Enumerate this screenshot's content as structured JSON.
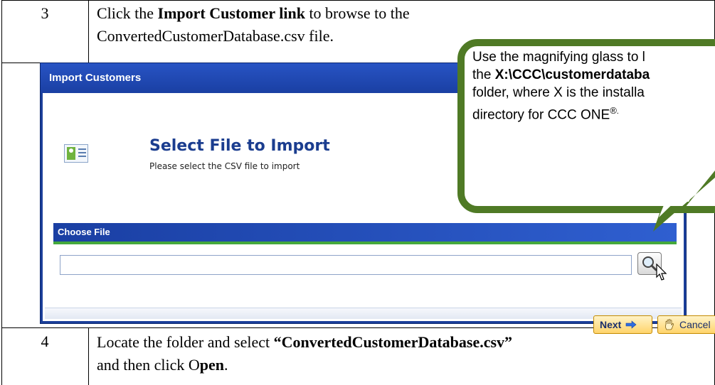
{
  "step3": {
    "number": "3",
    "prefix": "Click the ",
    "link": "Import Customer link",
    "suffix": " to browse to the",
    "line2": "ConvertedCustomerDatabase.csv file."
  },
  "step4": {
    "number": "4",
    "prefix": "Locate the folder and select ",
    "file": "“ConvertedCustomerDatabase.csv”",
    "line2_prefix": "and then click O",
    "line2_bold": "pen",
    "line2_suffix": "."
  },
  "dialog": {
    "title": "Import Customers",
    "header_title": "Select File to Import",
    "header_subtitle": "Please select the CSV file to import",
    "section_label": "Choose File",
    "file_value": "",
    "next_label": "Next",
    "cancel_label": "Cancel"
  },
  "callout": {
    "line1": "Use the magnifying glass to l",
    "line2_prefix": "the ",
    "line2_bold": "X:\\CCC\\customerdataba",
    "line3": "folder, where X is the installa",
    "line4": "directory for CCC ONE",
    "registered": "®",
    "period": "."
  },
  "colors": {
    "dialog_blue": "#1b3f9a",
    "header_title": "#1b3d8f",
    "section_green": "#44a83c",
    "callout_border": "#4f7a25",
    "button_gold": "#ffd46b"
  },
  "icons": {
    "header_icon": "contact-card-icon",
    "browse_icon": "magnifier-icon",
    "next_icon": "arrow-right-icon",
    "cancel_icon": "hand-stop-icon",
    "cursor": "mouse-pointer-icon"
  }
}
